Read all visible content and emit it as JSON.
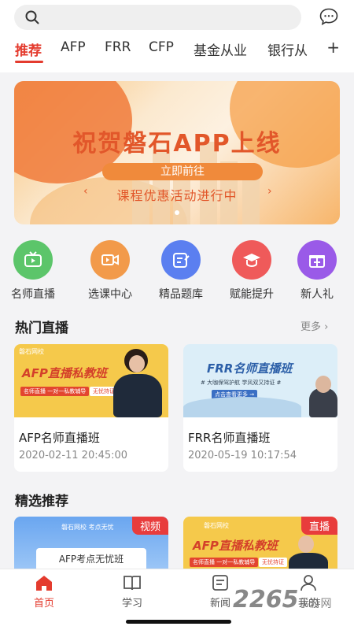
{
  "header": {
    "search_icon": "search-icon",
    "message_icon": "chat-bubble-icon"
  },
  "tabs": [
    {
      "label": "推荐",
      "active": true
    },
    {
      "label": "AFP"
    },
    {
      "label": "FRR"
    },
    {
      "label": "CFP"
    },
    {
      "label": "基金从业"
    },
    {
      "label": "银行从"
    }
  ],
  "tab_more": "+",
  "banner": {
    "title": "祝贺磐石APP上线",
    "button": "立即前往",
    "subtitle": "课程优惠活动进行中",
    "prev_arrow": "‹",
    "next_arrow": "›"
  },
  "quick_links": [
    {
      "label": "名师直播",
      "icon": "tv-icon",
      "color": "#5cc56a"
    },
    {
      "label": "选课中心",
      "icon": "video-camera-icon",
      "color": "#f29a4a"
    },
    {
      "label": "精品题库",
      "icon": "edit-note-icon",
      "color": "#5b7ff0"
    },
    {
      "label": "赋能提升",
      "icon": "graduation-cap-icon",
      "color": "#ef5a5a"
    },
    {
      "label": "新人礼",
      "icon": "gift-icon",
      "color": "#9a5ae8"
    }
  ],
  "hot_live": {
    "title": "热门直播",
    "more": "更多",
    "cards": [
      {
        "title": "AFP名师直播班",
        "time": "2020-02-11 20:45:00",
        "thumb_logo": "磐石网校",
        "thumb_heading": "AFP直播私教班",
        "thumb_pill_1": "名师直播 一对一私教辅导",
        "thumb_pill_2": "无忧持证"
      },
      {
        "title": "FRR名师直播班",
        "time": "2020-05-19 10:17:54",
        "thumb_heading": "FRR名师直播班",
        "thumb_tagline": "# 大咖保驾护航 学风双又持证 #",
        "thumb_pill_1": "点击查看更多 →"
      }
    ]
  },
  "featured": {
    "title": "精选推荐",
    "cards": [
      {
        "badge": "视频",
        "logo": "磐石网校 考点无忧",
        "caption": "AFP考点无忧班"
      },
      {
        "badge": "直播",
        "logo": "磐石网校",
        "heading": "AFP直播私教班",
        "pill_1": "名师直播 一对一私教辅导",
        "pill_2": "无忧持证"
      }
    ]
  },
  "bottom_nav": [
    {
      "label": "首页",
      "icon": "home-icon",
      "active": true
    },
    {
      "label": "学习",
      "icon": "book-icon"
    },
    {
      "label": "新闻",
      "icon": "news-icon"
    },
    {
      "label": "我的",
      "icon": "user-icon"
    }
  ],
  "watermark": {
    "text": "2265",
    "suffix": "手游网"
  },
  "colors": {
    "accent": "#e43b2e"
  }
}
